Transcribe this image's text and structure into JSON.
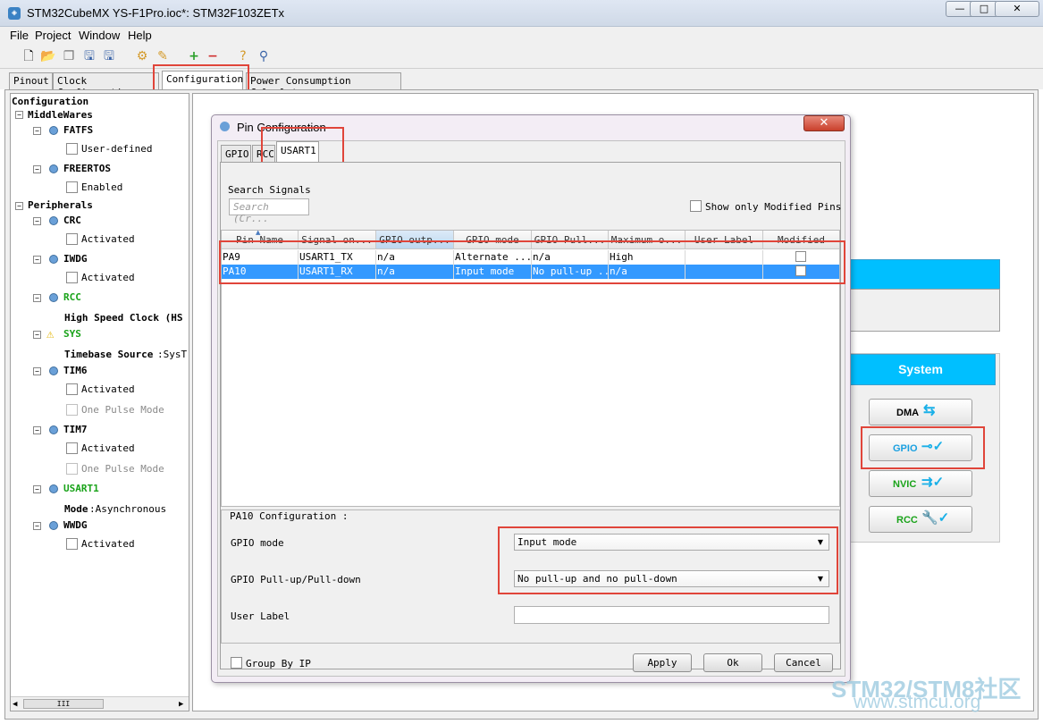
{
  "window": {
    "title": "STM32CubeMX YS-F1Pro.ioc*: STM32F103ZETx",
    "minimize": "—",
    "maximize": "□",
    "close": "✕"
  },
  "menu": [
    "File",
    "Project",
    "Window",
    "Help"
  ],
  "main_tabs": [
    "Pinout",
    "Clock Configuration",
    "Configuration",
    "Power Consumption Calculator"
  ],
  "tree": {
    "root": "Configuration",
    "middlewares": "MiddleWares",
    "fatfs": "FATFS",
    "user_defined": "User-defined",
    "freertos": "FREERTOS",
    "enabled": "Enabled",
    "peripherals": "Peripherals",
    "crc": "CRC",
    "activated": "Activated",
    "iwdg": "IWDG",
    "rcc": "RCC",
    "rcc_child_label": "High Speed Clock (HS",
    "sys": "SYS",
    "sys_child_key": "Timebase Source",
    "sys_child_val": ":SysT",
    "tim6": "TIM6",
    "one_pulse": "One Pulse Mode",
    "tim7": "TIM7",
    "usart1": "USART1",
    "usart_mode_key": "Mode",
    "usart_mode_val": ":Asynchronous",
    "wwdg": "WWDG",
    "scroll_grip": "III"
  },
  "system_panel": {
    "title": "System",
    "buttons": [
      {
        "label": "DMA",
        "icon": "dma-icon"
      },
      {
        "label": "GPIO",
        "icon": "gpio-icon"
      },
      {
        "label": "NVIC",
        "icon": "nvic-icon"
      },
      {
        "label": "RCC",
        "icon": "rcc-icon"
      }
    ]
  },
  "dialog": {
    "title": "Pin Configuration",
    "close": "✕",
    "tabs": [
      "GPIO",
      "RCC",
      "USART1"
    ],
    "search_label": "Search Signals",
    "search_placeholder": "Search (Cr...",
    "show_modified": "Show only Modified Pins",
    "columns": [
      "Pin Name",
      "Signal on...",
      "GPIO outp...",
      "GPIO mode",
      "GPIO Pull...",
      "Maximum o...",
      "User Label",
      "Modified"
    ],
    "rows": [
      [
        "PA9",
        "USART1_TX",
        "n/a",
        "Alternate ...",
        "n/a",
        "High",
        "",
        ""
      ],
      [
        "PA10",
        "USART1_RX",
        "n/a",
        "Input mode",
        "No pull-up ...",
        "n/a",
        "",
        ""
      ]
    ],
    "config_title": "PA10 Configuration :",
    "gpio_mode_label": "GPIO mode",
    "gpio_mode_value": "Input mode",
    "pull_label": "GPIO Pull-up/Pull-down",
    "pull_value": "No pull-up and no pull-down",
    "user_label": "User Label",
    "user_label_value": "",
    "group_by_ip": "Group By IP",
    "apply": "Apply",
    "ok": "Ok",
    "cancel": "Cancel"
  },
  "watermark": {
    "line1": "STM32/STM8社区",
    "line2": "www.stmcu.org"
  },
  "colors": {
    "accent": "#00bfff",
    "highlight": "#e0453a",
    "selection": "#3399ff",
    "green": "#1aa31a"
  }
}
